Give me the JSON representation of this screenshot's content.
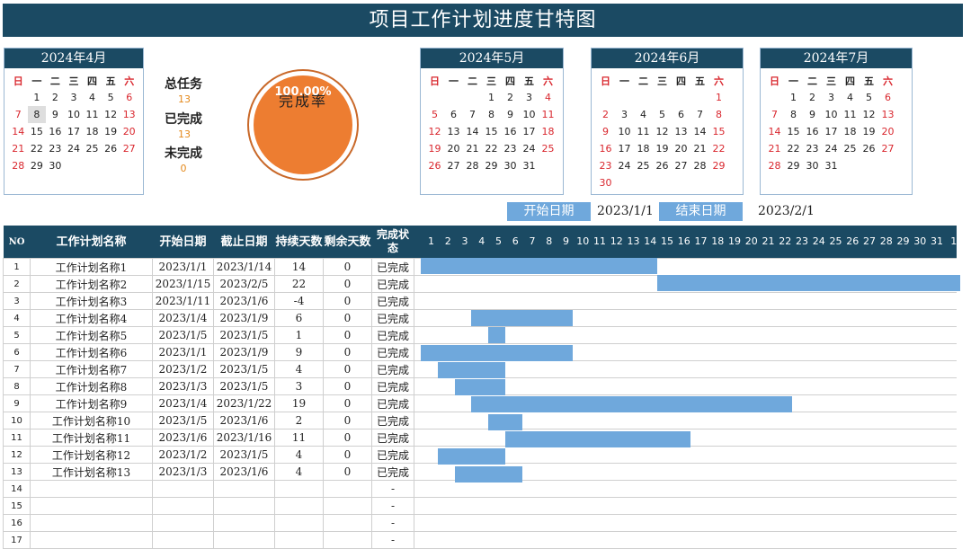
{
  "title": "项目工作计划进度甘特图",
  "weekday_headers": [
    "日",
    "一",
    "二",
    "三",
    "四",
    "五",
    "六"
  ],
  "calendars": [
    {
      "title": "2024年4月",
      "weeks": [
        [
          "",
          "1",
          "2",
          "3",
          "4",
          "5",
          "6"
        ],
        [
          "7",
          "8",
          "9",
          "10",
          "11",
          "12",
          "13"
        ],
        [
          "14",
          "15",
          "16",
          "17",
          "18",
          "19",
          "20"
        ],
        [
          "21",
          "22",
          "23",
          "24",
          "25",
          "26",
          "27"
        ],
        [
          "28",
          "29",
          "30",
          "",
          "",
          "",
          ""
        ]
      ]
    },
    {
      "title": "2024年5月",
      "weeks": [
        [
          "",
          "",
          "",
          "1",
          "2",
          "3",
          "4"
        ],
        [
          "5",
          "6",
          "7",
          "8",
          "9",
          "10",
          "11"
        ],
        [
          "12",
          "13",
          "14",
          "15",
          "16",
          "17",
          "18"
        ],
        [
          "19",
          "20",
          "21",
          "22",
          "23",
          "24",
          "25"
        ],
        [
          "26",
          "27",
          "28",
          "29",
          "30",
          "31",
          ""
        ]
      ]
    },
    {
      "title": "2024年6月",
      "weeks": [
        [
          "",
          "",
          "",
          "",
          "",
          "",
          "1"
        ],
        [
          "2",
          "3",
          "4",
          "5",
          "6",
          "7",
          "8"
        ],
        [
          "9",
          "10",
          "11",
          "12",
          "13",
          "14",
          "15"
        ],
        [
          "16",
          "17",
          "18",
          "19",
          "20",
          "21",
          "22"
        ],
        [
          "23",
          "24",
          "25",
          "26",
          "27",
          "28",
          "29"
        ],
        [
          "30",
          "",
          "",
          "",
          "",
          "",
          ""
        ]
      ]
    },
    {
      "title": "2024年7月",
      "weeks": [
        [
          "",
          "1",
          "2",
          "3",
          "4",
          "5",
          "6"
        ],
        [
          "7",
          "8",
          "9",
          "10",
          "11",
          "12",
          "13"
        ],
        [
          "14",
          "15",
          "16",
          "17",
          "18",
          "19",
          "20"
        ],
        [
          "21",
          "22",
          "23",
          "24",
          "25",
          "26",
          "27"
        ],
        [
          "28",
          "29",
          "30",
          "31",
          "",
          "",
          ""
        ]
      ]
    }
  ],
  "stats": {
    "total_label": "总任务",
    "total_value": "13",
    "done_label": "已完成",
    "done_value": "13",
    "undone_label": "未完成",
    "undone_value": "0"
  },
  "completion": {
    "label": "完成率",
    "percent": "100.00%",
    "ratio": 1.0
  },
  "date_range": {
    "start_label": "开始日期",
    "start_value": "2023/1/1",
    "end_label": "结束日期",
    "end_value": "2023/2/1"
  },
  "table": {
    "headers": {
      "no": "NO",
      "name": "工作计划名称",
      "start": "开始日期",
      "end": "截止日期",
      "duration": "持续天数",
      "remaining": "剩余天数",
      "status": "完成状态"
    },
    "day_numbers": [
      "1",
      "2",
      "3",
      "4",
      "5",
      "6",
      "7",
      "8",
      "9",
      "10",
      "11",
      "12",
      "13",
      "14",
      "15",
      "16",
      "17",
      "18",
      "19",
      "20",
      "21",
      "22",
      "23",
      "24",
      "25",
      "26",
      "27",
      "28",
      "29",
      "30",
      "31",
      "1"
    ],
    "rows": [
      {
        "no": "1",
        "name": "工作计划名称1",
        "start": "2023/1/1",
        "end": "2023/1/14",
        "duration": "14",
        "remaining": "0",
        "status": "已完成",
        "bar_start_day": 1,
        "bar_end_day": 14
      },
      {
        "no": "2",
        "name": "工作计划名称2",
        "start": "2023/1/15",
        "end": "2023/2/5",
        "duration": "22",
        "remaining": "0",
        "status": "已完成",
        "bar_start_day": 15,
        "bar_end_day": 32
      },
      {
        "no": "3",
        "name": "工作计划名称3",
        "start": "2023/1/11",
        "end": "2023/1/6",
        "duration": "-4",
        "remaining": "0",
        "status": "已完成",
        "bar_start_day": null,
        "bar_end_day": null
      },
      {
        "no": "4",
        "name": "工作计划名称4",
        "start": "2023/1/4",
        "end": "2023/1/9",
        "duration": "6",
        "remaining": "0",
        "status": "已完成",
        "bar_start_day": 4,
        "bar_end_day": 9
      },
      {
        "no": "5",
        "name": "工作计划名称5",
        "start": "2023/1/5",
        "end": "2023/1/5",
        "duration": "1",
        "remaining": "0",
        "status": "已完成",
        "bar_start_day": 5,
        "bar_end_day": 5
      },
      {
        "no": "6",
        "name": "工作计划名称6",
        "start": "2023/1/1",
        "end": "2023/1/9",
        "duration": "9",
        "remaining": "0",
        "status": "已完成",
        "bar_start_day": 1,
        "bar_end_day": 9
      },
      {
        "no": "7",
        "name": "工作计划名称7",
        "start": "2023/1/2",
        "end": "2023/1/5",
        "duration": "4",
        "remaining": "0",
        "status": "已完成",
        "bar_start_day": 2,
        "bar_end_day": 5
      },
      {
        "no": "8",
        "name": "工作计划名称8",
        "start": "2023/1/3",
        "end": "2023/1/5",
        "duration": "3",
        "remaining": "0",
        "status": "已完成",
        "bar_start_day": 3,
        "bar_end_day": 5
      },
      {
        "no": "9",
        "name": "工作计划名称9",
        "start": "2023/1/4",
        "end": "2023/1/22",
        "duration": "19",
        "remaining": "0",
        "status": "已完成",
        "bar_start_day": 4,
        "bar_end_day": 22
      },
      {
        "no": "10",
        "name": "工作计划名称10",
        "start": "2023/1/5",
        "end": "2023/1/6",
        "duration": "2",
        "remaining": "0",
        "status": "已完成",
        "bar_start_day": 5,
        "bar_end_day": 6
      },
      {
        "no": "11",
        "name": "工作计划名称11",
        "start": "2023/1/6",
        "end": "2023/1/16",
        "duration": "11",
        "remaining": "0",
        "status": "已完成",
        "bar_start_day": 6,
        "bar_end_day": 16
      },
      {
        "no": "12",
        "name": "工作计划名称12",
        "start": "2023/1/2",
        "end": "2023/1/5",
        "duration": "4",
        "remaining": "0",
        "status": "已完成",
        "bar_start_day": 2,
        "bar_end_day": 5
      },
      {
        "no": "13",
        "name": "工作计划名称13",
        "start": "2023/1/3",
        "end": "2023/1/6",
        "duration": "4",
        "remaining": "0",
        "status": "已完成",
        "bar_start_day": 3,
        "bar_end_day": 6
      },
      {
        "no": "14",
        "name": "",
        "start": "",
        "end": "",
        "duration": "",
        "remaining": "",
        "status": "-",
        "bar_start_day": null,
        "bar_end_day": null
      },
      {
        "no": "15",
        "name": "",
        "start": "",
        "end": "",
        "duration": "",
        "remaining": "",
        "status": "-",
        "bar_start_day": null,
        "bar_end_day": null
      },
      {
        "no": "16",
        "name": "",
        "start": "",
        "end": "",
        "duration": "",
        "remaining": "",
        "status": "-",
        "bar_start_day": null,
        "bar_end_day": null
      },
      {
        "no": "17",
        "name": "",
        "start": "",
        "end": "",
        "duration": "",
        "remaining": "",
        "status": "-",
        "bar_start_day": null,
        "bar_end_day": null
      }
    ]
  },
  "colors": {
    "header_bg": "#1b4a63",
    "bar": "#6fa8dc",
    "ring": "#ed7d31",
    "weekend": "#d9272e",
    "stat_value": "#e4891b"
  }
}
